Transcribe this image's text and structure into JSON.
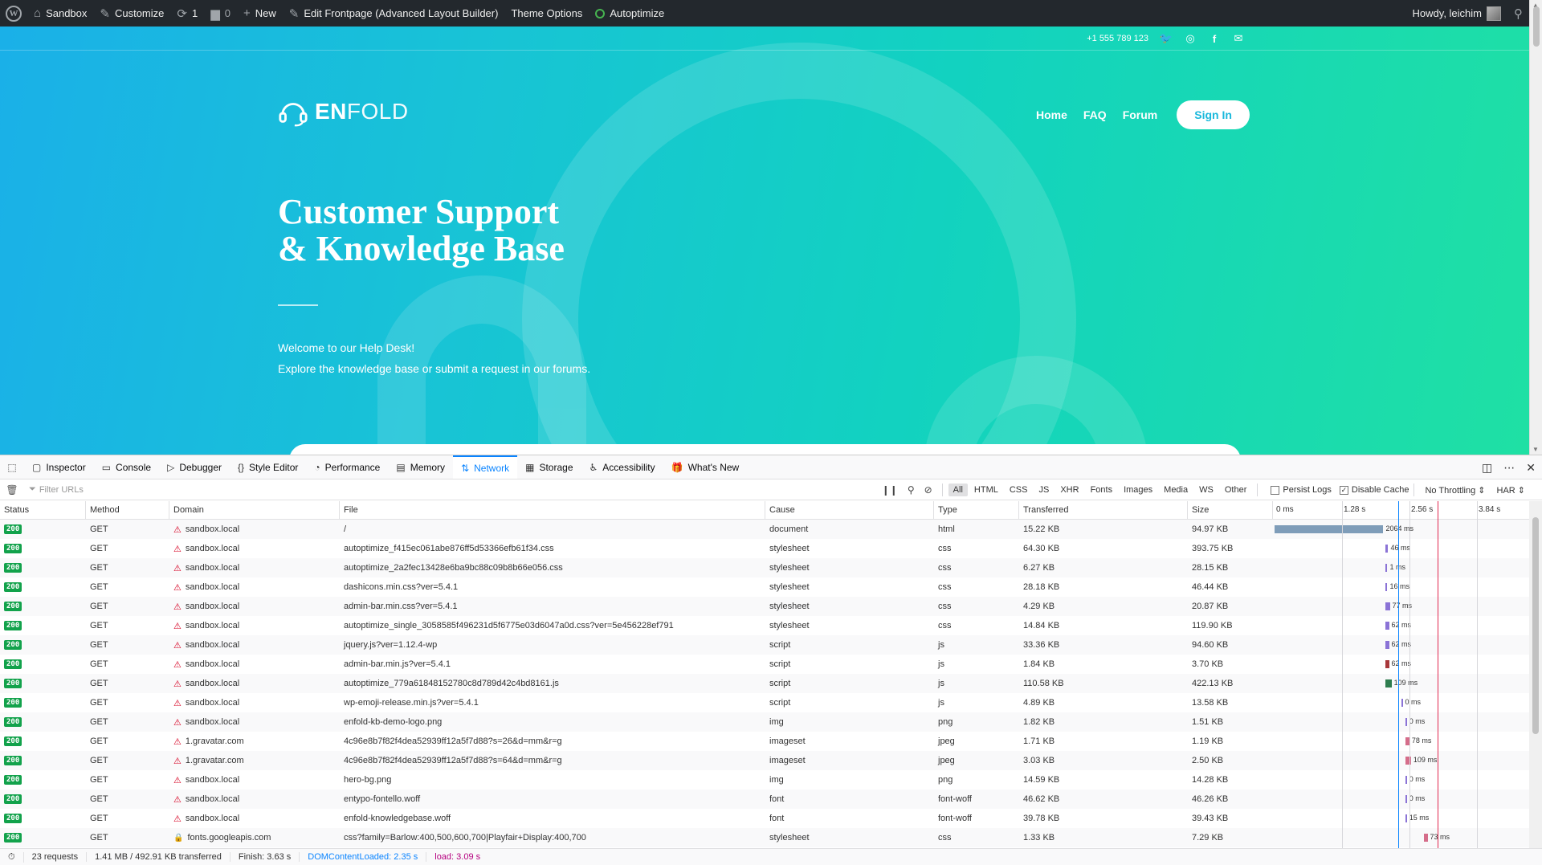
{
  "admin_bar": {
    "site": "Sandbox",
    "customize": "Customize",
    "updates": "1",
    "comments": "0",
    "new": "New",
    "edit": "Edit Frontpage (Advanced Layout Builder)",
    "theme_options": "Theme Options",
    "autoptimize": "Autoptimize",
    "howdy": "Howdy, leichim"
  },
  "hero": {
    "phone": "+1 555 789 123",
    "logo_bold": "EN",
    "logo_light": "FOLD",
    "nav": [
      "Home",
      "FAQ",
      "Forum"
    ],
    "signin": "Sign In",
    "title_line1": "Customer Support",
    "title_line2": "& Knowledge Base",
    "text1": "Welcome to our Help Desk!",
    "text2": "Explore the knowledge base or submit a request in our forums."
  },
  "devtools": {
    "tabs": [
      "Inspector",
      "Console",
      "Debugger",
      "Style Editor",
      "Performance",
      "Memory",
      "Network",
      "Storage",
      "Accessibility",
      "What's New"
    ],
    "active_tab": "Network",
    "filter_placeholder": "Filter URLs",
    "filters": [
      "All",
      "HTML",
      "CSS",
      "JS",
      "XHR",
      "Fonts",
      "Images",
      "Media",
      "WS",
      "Other"
    ],
    "persist_logs": "Persist Logs",
    "disable_cache": "Disable Cache",
    "throttling": "No Throttling ⇕",
    "har": "HAR ⇕",
    "columns": {
      "status": "Status",
      "method": "Method",
      "domain": "Domain",
      "file": "File",
      "cause": "Cause",
      "type": "Type",
      "transferred": "Transferred",
      "size": "Size"
    },
    "timeline": [
      "0 ms",
      "1.28 s",
      "2.56 s",
      "3.84 s"
    ],
    "rows": [
      {
        "status": "200",
        "method": "GET",
        "domain": "sandbox.local",
        "file": "/",
        "cause": "document",
        "type": "html",
        "transferred": "15.22 KB",
        "size": "94.97 KB",
        "time": "2064 ms",
        "start": 0,
        "dur": 2064,
        "color": "#7f9db9"
      },
      {
        "status": "200",
        "method": "GET",
        "domain": "sandbox.local",
        "file": "autoptimize_f415ec061abe876ff5d53366efb61f34.css",
        "cause": "stylesheet",
        "type": "css",
        "transferred": "64.30 KB",
        "size": "393.75 KB",
        "time": "46 ms",
        "start": 2110,
        "dur": 46,
        "color": "#8b73d6"
      },
      {
        "status": "200",
        "method": "GET",
        "domain": "sandbox.local",
        "file": "autoptimize_2a2fec13428e6ba9bc88c09b8b66e056.css",
        "cause": "stylesheet",
        "type": "css",
        "transferred": "6.27 KB",
        "size": "28.15 KB",
        "time": "1 ms",
        "start": 2110,
        "dur": 1,
        "color": "#8b73d6"
      },
      {
        "status": "200",
        "method": "GET",
        "domain": "sandbox.local",
        "file": "dashicons.min.css?ver=5.4.1",
        "cause": "stylesheet",
        "type": "css",
        "transferred": "28.18 KB",
        "size": "46.44 KB",
        "time": "16 ms",
        "start": 2110,
        "dur": 16,
        "color": "#8b73d6"
      },
      {
        "status": "200",
        "method": "GET",
        "domain": "sandbox.local",
        "file": "admin-bar.min.css?ver=5.4.1",
        "cause": "stylesheet",
        "type": "css",
        "transferred": "4.29 KB",
        "size": "20.87 KB",
        "time": "77 ms",
        "start": 2110,
        "dur": 77,
        "color": "#8b73d6"
      },
      {
        "status": "200",
        "method": "GET",
        "domain": "sandbox.local",
        "file": "autoptimize_single_3058585f496231d5f6775e03d6047a0d.css?ver=5e456228ef791",
        "cause": "stylesheet",
        "type": "css",
        "transferred": "14.84 KB",
        "size": "119.90 KB",
        "time": "62 ms",
        "start": 2110,
        "dur": 62,
        "color": "#8b73d6"
      },
      {
        "status": "200",
        "method": "GET",
        "domain": "sandbox.local",
        "file": "jquery.js?ver=1.12.4-wp",
        "cause": "script",
        "type": "js",
        "transferred": "33.36 KB",
        "size": "94.60 KB",
        "time": "62 ms",
        "start": 2110,
        "dur": 62,
        "color": "#8b73d6"
      },
      {
        "status": "200",
        "method": "GET",
        "domain": "sandbox.local",
        "file": "admin-bar.min.js?ver=5.4.1",
        "cause": "script",
        "type": "js",
        "transferred": "1.84 KB",
        "size": "3.70 KB",
        "time": "62 ms",
        "start": 2110,
        "dur": 62,
        "color": "#a8383b"
      },
      {
        "status": "200",
        "method": "GET",
        "domain": "sandbox.local",
        "file": "autoptimize_779a61848152780c8d789d42c4bd8161.js",
        "cause": "script",
        "type": "js",
        "transferred": "110.58 KB",
        "size": "422.13 KB",
        "time": "109 ms",
        "start": 2110,
        "dur": 109,
        "color": "#2f7d4f"
      },
      {
        "status": "200",
        "method": "GET",
        "domain": "sandbox.local",
        "file": "wp-emoji-release.min.js?ver=5.4.1",
        "cause": "script",
        "type": "js",
        "transferred": "4.89 KB",
        "size": "13.58 KB",
        "time": "0 ms",
        "start": 2400,
        "dur": 0,
        "color": "#8b73d6"
      },
      {
        "status": "200",
        "method": "GET",
        "domain": "sandbox.local",
        "file": "enfold-kb-demo-logo.png",
        "cause": "img",
        "type": "png",
        "transferred": "1.82 KB",
        "size": "1.51 KB",
        "time": "0 ms",
        "start": 2480,
        "dur": 0,
        "color": "#8b73d6"
      },
      {
        "status": "200",
        "method": "GET",
        "domain": "1.gravatar.com",
        "file": "4c96e8b7f82f4dea52939ff12a5f7d88?s=26&d=mm&r=g",
        "cause": "imageset",
        "type": "jpeg",
        "transferred": "1.71 KB",
        "size": "1.19 KB",
        "time": "78 ms",
        "start": 2480,
        "dur": 78,
        "color": "#d56d8a"
      },
      {
        "status": "200",
        "method": "GET",
        "domain": "1.gravatar.com",
        "file": "4c96e8b7f82f4dea52939ff12a5f7d88?s=64&d=mm&r=g",
        "cause": "imageset",
        "type": "jpeg",
        "transferred": "3.03 KB",
        "size": "2.50 KB",
        "time": "109 ms",
        "start": 2480,
        "dur": 109,
        "color": "#d56d8a"
      },
      {
        "status": "200",
        "method": "GET",
        "domain": "sandbox.local",
        "file": "hero-bg.png",
        "cause": "img",
        "type": "png",
        "transferred": "14.59 KB",
        "size": "14.28 KB",
        "time": "0 ms",
        "start": 2480,
        "dur": 0,
        "color": "#8b73d6"
      },
      {
        "status": "200",
        "method": "GET",
        "domain": "sandbox.local",
        "file": "entypo-fontello.woff",
        "cause": "font",
        "type": "font-woff",
        "transferred": "46.62 KB",
        "size": "46.26 KB",
        "time": "0 ms",
        "start": 2480,
        "dur": 0,
        "color": "#8b73d6"
      },
      {
        "status": "200",
        "method": "GET",
        "domain": "sandbox.local",
        "file": "enfold-knowledgebase.woff",
        "cause": "font",
        "type": "font-woff",
        "transferred": "39.78 KB",
        "size": "39.43 KB",
        "time": "15 ms",
        "start": 2480,
        "dur": 15,
        "color": "#8b73d6"
      },
      {
        "status": "200",
        "method": "GET",
        "domain": "fonts.googleapis.com",
        "file": "css?family=Barlow:400,500,600,700|Playfair+Display:400,700",
        "cause": "stylesheet",
        "type": "css",
        "transferred": "1.33 KB",
        "size": "7.29 KB",
        "time": "73 ms",
        "start": 2830,
        "dur": 73,
        "color": "#d56d8a",
        "lock": true
      }
    ],
    "status": {
      "requests": "23 requests",
      "transferred": "1.41 MB / 492.91 KB transferred",
      "finish": "Finish: 3.63 s",
      "dcl": "DOMContentLoaded: 2.35 s",
      "load": "load: 3.09 s"
    }
  }
}
